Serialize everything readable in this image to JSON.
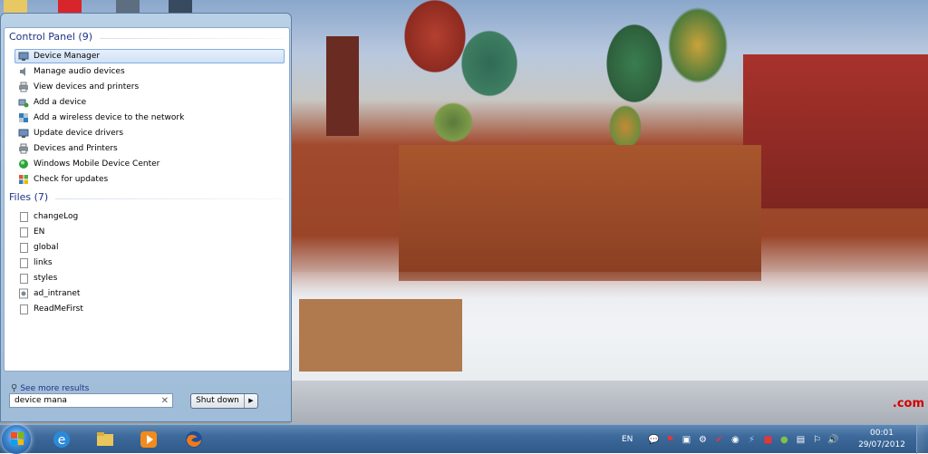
{
  "desktop": {
    "watermark": ".com"
  },
  "start_menu": {
    "groups": [
      {
        "header": "Control Panel (9)",
        "items": [
          {
            "label": "Device Manager",
            "icon": "device-manager-icon",
            "selected": true
          },
          {
            "label": "Manage audio devices",
            "icon": "speaker-icon"
          },
          {
            "label": "View devices and printers",
            "icon": "printer-icon"
          },
          {
            "label": "Add a device",
            "icon": "add-device-icon"
          },
          {
            "label": "Add a wireless device to the network",
            "icon": "wireless-device-icon"
          },
          {
            "label": "Update device drivers",
            "icon": "device-drivers-icon"
          },
          {
            "label": "Devices and Printers",
            "icon": "printer-icon"
          },
          {
            "label": "Windows Mobile Device Center",
            "icon": "mobile-device-center-icon"
          },
          {
            "label": "Check for updates",
            "icon": "windows-update-icon"
          }
        ]
      },
      {
        "header": "Files (7)",
        "items": [
          {
            "label": "changeLog",
            "icon": "file-icon"
          },
          {
            "label": "EN",
            "icon": "file-icon"
          },
          {
            "label": "global",
            "icon": "file-icon"
          },
          {
            "label": "links",
            "icon": "file-icon"
          },
          {
            "label": "styles",
            "icon": "file-icon"
          },
          {
            "label": "ad_intranet",
            "icon": "settings-file-icon"
          },
          {
            "label": "ReadMeFirst",
            "icon": "file-icon"
          }
        ]
      }
    ],
    "see_more": "See more results",
    "search_value": "device mana",
    "shutdown_label": "Shut down"
  },
  "taskbar": {
    "pinned": [
      {
        "name": "internet-explorer-icon"
      },
      {
        "name": "windows-explorer-icon"
      },
      {
        "name": "media-player-icon"
      },
      {
        "name": "firefox-icon"
      }
    ],
    "language": "EN",
    "clock": {
      "time": "00:01",
      "date": "29/07/2012"
    }
  },
  "colors": {
    "accent": "#1e3287",
    "taskbar": "#3d6a9b",
    "selection": "#cfe2f6"
  }
}
